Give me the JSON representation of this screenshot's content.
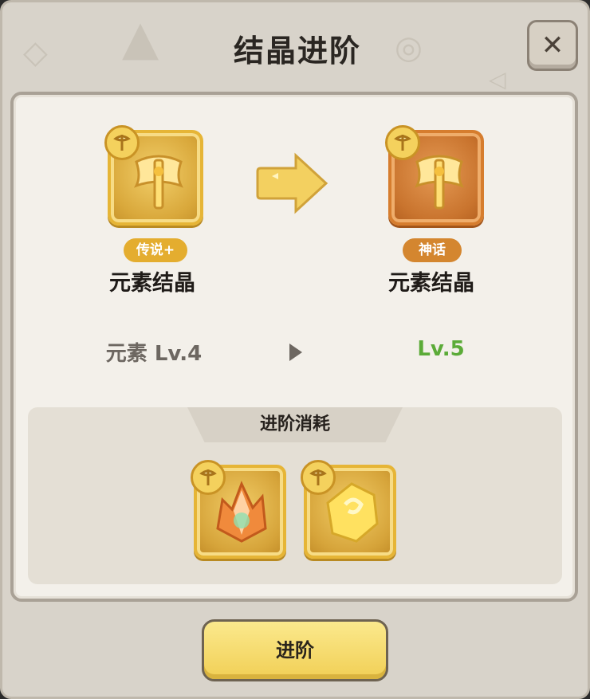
{
  "dialog": {
    "title": "结晶进阶",
    "close_label": "✕"
  },
  "from_item": {
    "rarity": "传说+",
    "name": "元素结晶",
    "level_text": "元素  Lv.4",
    "icon": "golden-axe-icon"
  },
  "to_item": {
    "rarity": "神话",
    "name": "元素结晶",
    "level_text": "Lv.5",
    "icon": "golden-axe-icon"
  },
  "cost": {
    "header": "进阶消耗",
    "materials": [
      {
        "icon": "orange-crystal-icon"
      },
      {
        "icon": "golden-stone-icon"
      }
    ]
  },
  "action": {
    "advance_label": "进阶"
  },
  "colors": {
    "legend": "#e4ad2f",
    "mythic": "#d4862f",
    "level_up": "#5bab38"
  }
}
